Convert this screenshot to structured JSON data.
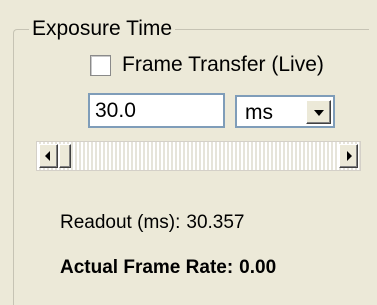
{
  "group": {
    "title": "Exposure Time"
  },
  "frame_transfer": {
    "label": "Frame Transfer (Live)",
    "checked": false
  },
  "exposure": {
    "value": "30.0",
    "unit": "ms",
    "unit_dropdown_icon": "chevron-down-icon"
  },
  "slider": {
    "left_icon": "arrow-left-icon",
    "right_icon": "arrow-right-icon",
    "position": 0
  },
  "readout": {
    "label": "Readout (ms):",
    "value": "30.357"
  },
  "frame_rate": {
    "label": "Actual Frame Rate:",
    "value": "0.00"
  }
}
